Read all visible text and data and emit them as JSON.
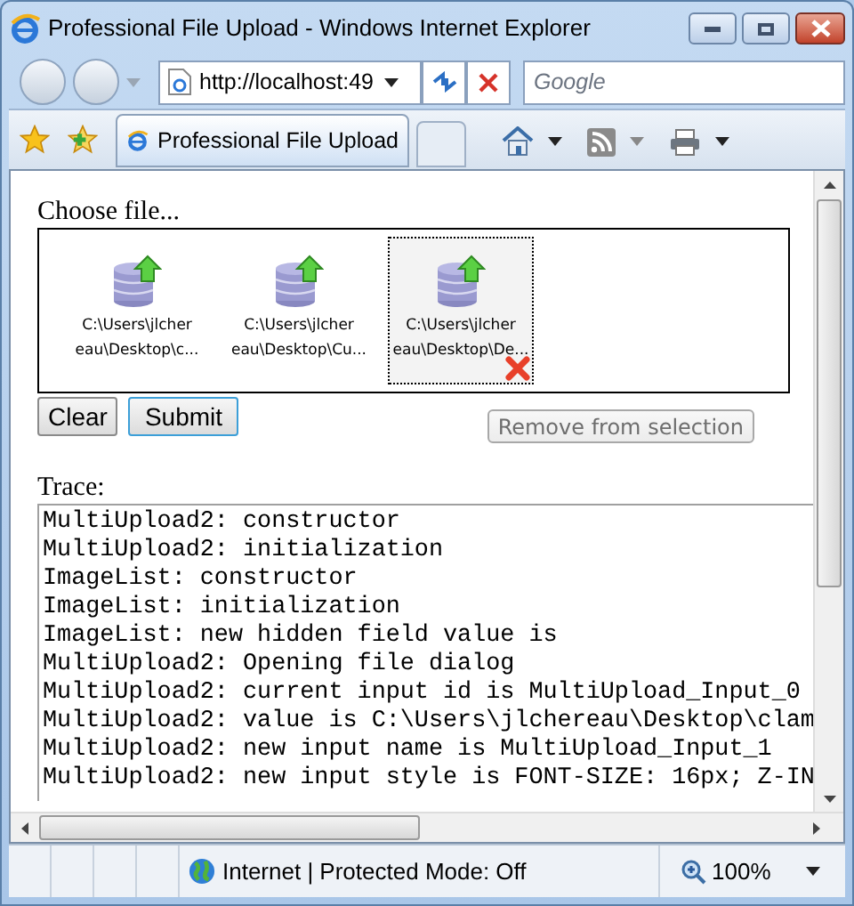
{
  "window": {
    "title": "Professional File Upload - Windows Internet Explorer"
  },
  "address_bar": {
    "value": "http://localhost:49"
  },
  "search": {
    "placeholder": "Google"
  },
  "tabs": [
    {
      "label": "Professional File Upload",
      "selected": true
    }
  ],
  "page": {
    "choose_label": "Choose file...",
    "files": [
      {
        "path": "C:\\Users\\jlcher eau\\Desktop\\c...",
        "selected": false
      },
      {
        "path": "C:\\Users\\jlcher eau\\Desktop\\Cu...",
        "selected": false
      },
      {
        "path": "C:\\Users\\jlcher eau\\Desktop\\De...",
        "selected": true
      }
    ],
    "buttons": [
      {
        "label": "Clear",
        "focused": false
      },
      {
        "label": "Submit",
        "focused": true
      }
    ],
    "remove_button": {
      "label": "Remove from selection",
      "disabled": true
    },
    "trace_label": "Trace:",
    "trace_lines": [
      "MultiUpload2: constructor",
      "MultiUpload2: initialization",
      "ImageList: constructor",
      "ImageList: initialization",
      "ImageList: new hidden field value is",
      "MultiUpload2: Opening file dialog",
      "MultiUpload2: current input id is MultiUpload_Input_0",
      "MultiUpload2: value is C:\\Users\\jlchereau\\Desktop\\clam",
      "MultiUpload2: new input name is MultiUpload_Input_1",
      "MultiUpload2: new input style is FONT-SIZE: 16px; Z-IN"
    ]
  },
  "status_bar": {
    "zone": "Internet | Protected Mode: Off",
    "zoom": "100%"
  }
}
